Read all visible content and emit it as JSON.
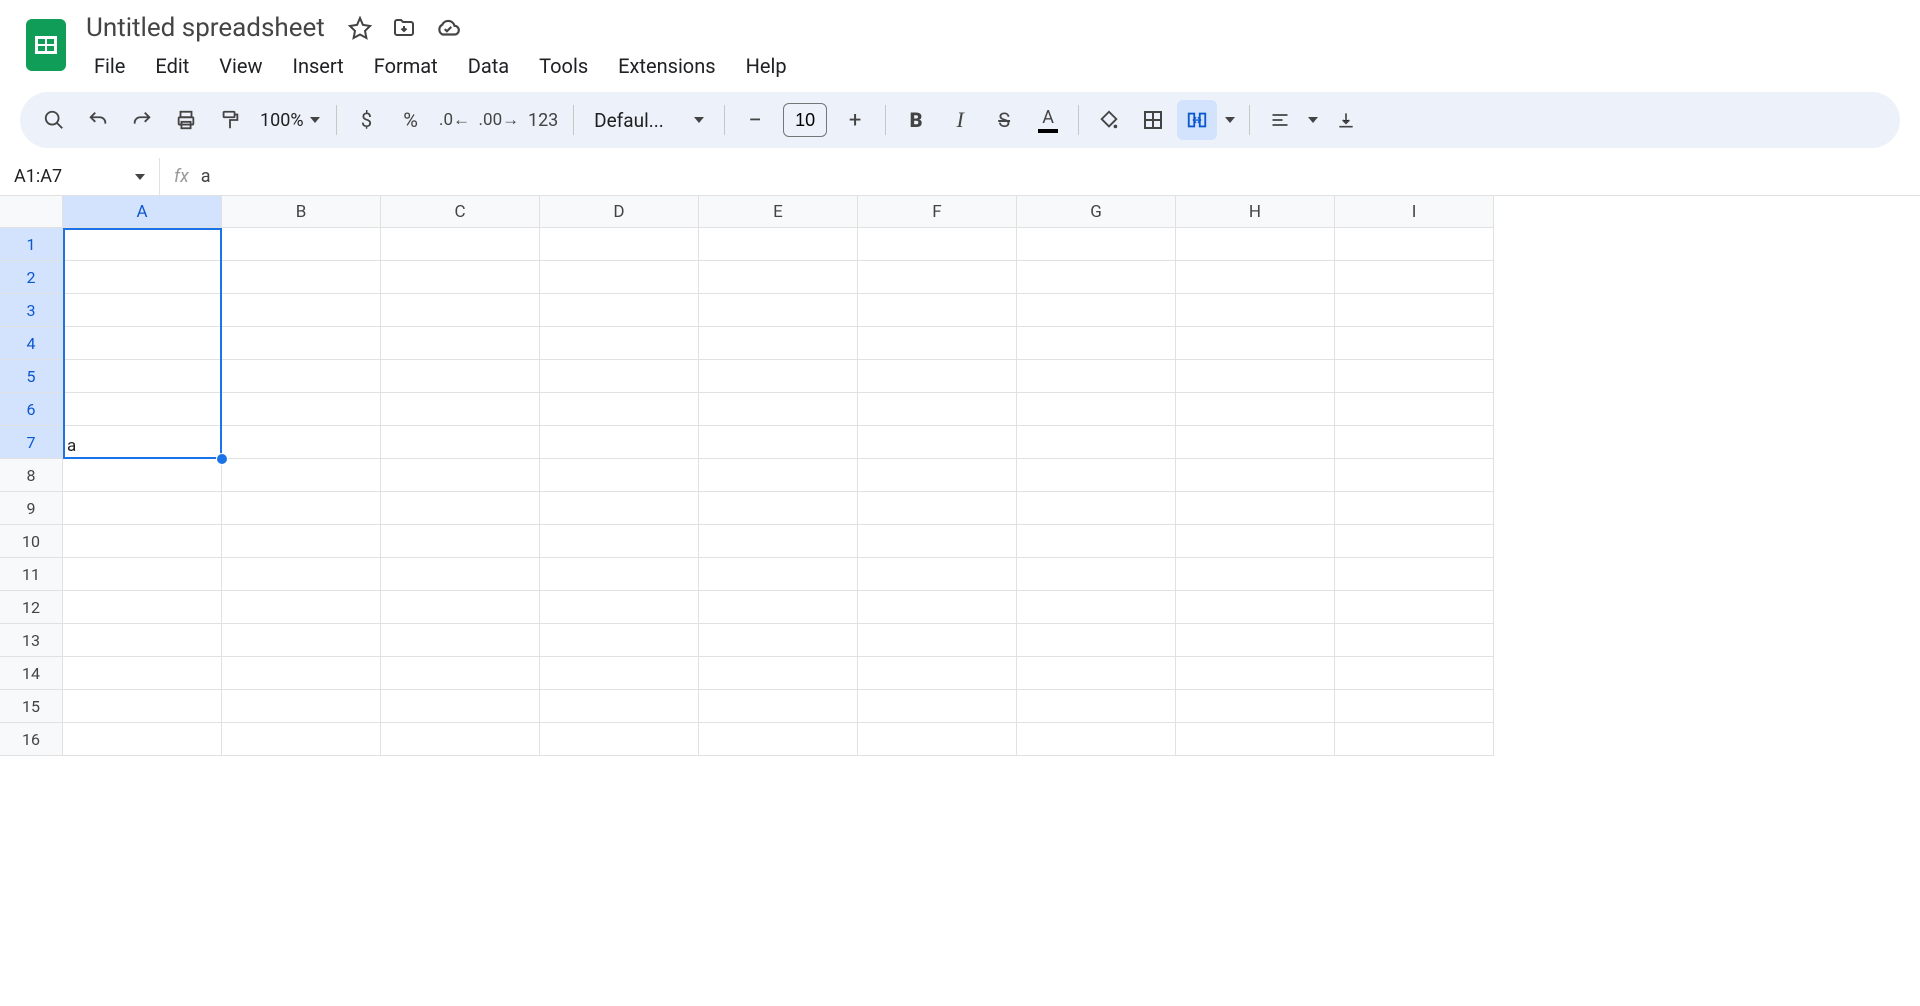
{
  "document": {
    "title": "Untitled spreadsheet"
  },
  "menubar": [
    "File",
    "Edit",
    "View",
    "Insert",
    "Format",
    "Data",
    "Tools",
    "Extensions",
    "Help"
  ],
  "toolbar": {
    "zoom": "100%",
    "font": "Defaul...",
    "font_size": "10",
    "format_number": "123"
  },
  "namebox": "A1:A7",
  "formula": "a",
  "columns": [
    "A",
    "B",
    "C",
    "D",
    "E",
    "F",
    "G",
    "H",
    "I"
  ],
  "rows": [
    "1",
    "2",
    "3",
    "4",
    "5",
    "6",
    "7",
    "8",
    "9",
    "10",
    "11",
    "12",
    "13",
    "14",
    "15",
    "16"
  ],
  "selected_col": "A",
  "selected_rows": [
    1,
    2,
    3,
    4,
    5,
    6,
    7
  ],
  "cell_a7": "a",
  "colors": {
    "accent": "#1a73e8",
    "sheets_green": "#0f9d58"
  }
}
